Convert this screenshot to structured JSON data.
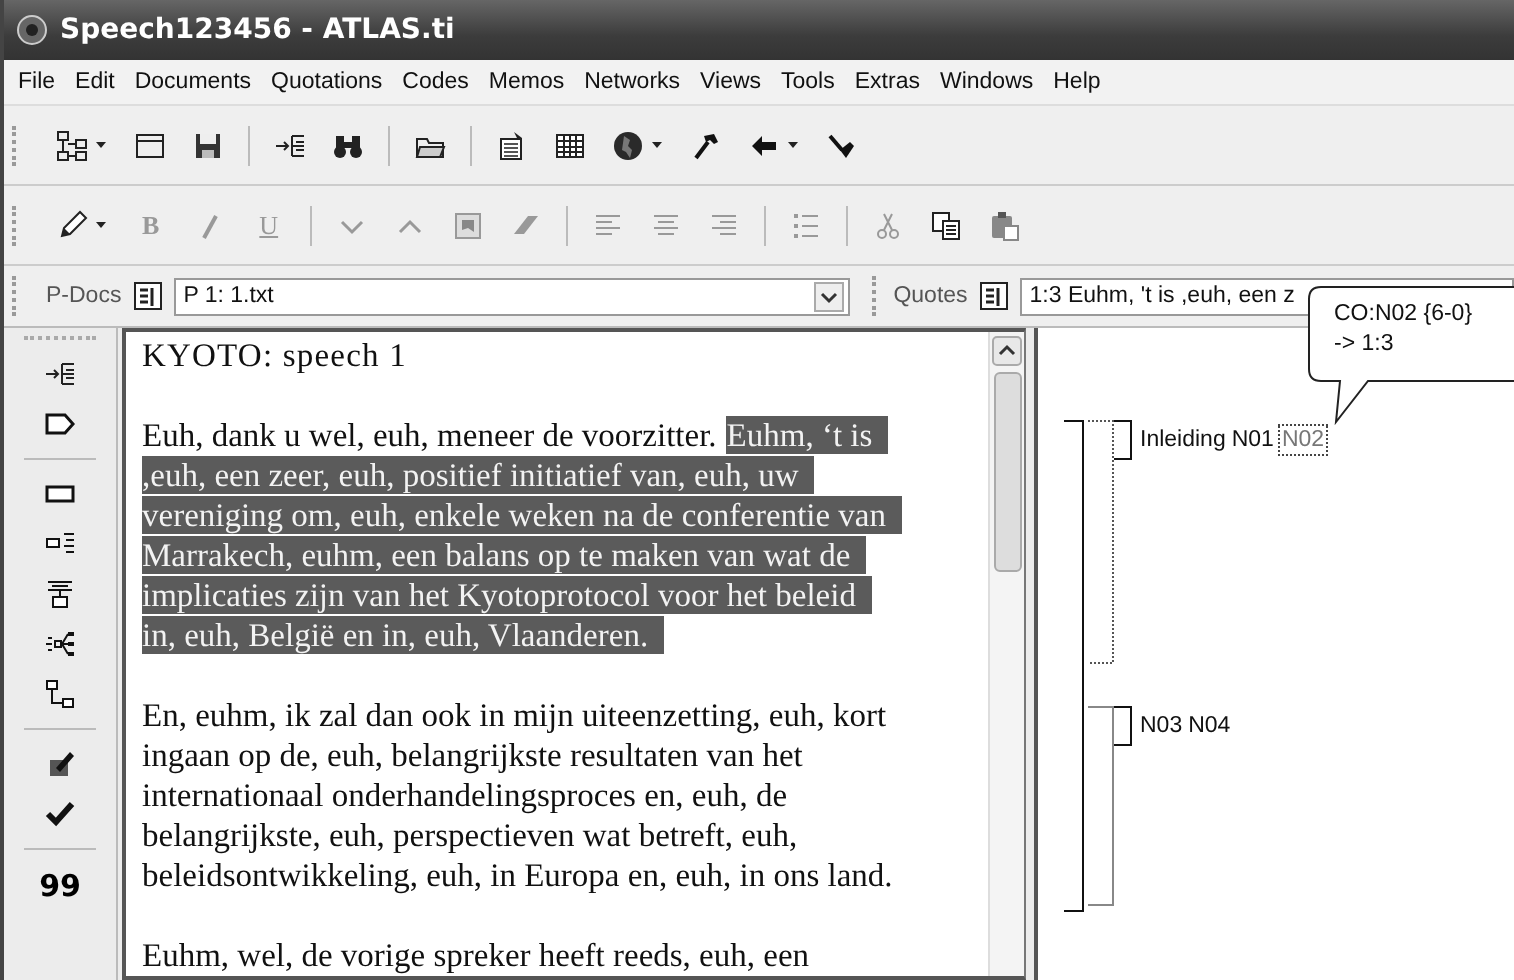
{
  "window": {
    "title": "Speech123456 - ATLAS.ti"
  },
  "menu": [
    "File",
    "Edit",
    "Documents",
    "Quotations",
    "Codes",
    "Memos",
    "Networks",
    "Views",
    "Tools",
    "Extras",
    "Windows",
    "Help"
  ],
  "format_buttons": [
    {
      "label": "B",
      "disabled": true
    },
    {
      "label": "U",
      "disabled": true
    }
  ],
  "pdocs": {
    "label": "P-Docs",
    "value": "P 1: 1.txt"
  },
  "quotes": {
    "label": "Quotes",
    "value": "1:3 Euhm, 't is ,euh, een z"
  },
  "tooltip": {
    "lines": [
      "CO:N02 {6-0}",
      "-> 1:3"
    ]
  },
  "left_toolbar": {
    "label": "99"
  },
  "document": {
    "paragraphs": [
      {
        "kind": "heading",
        "lines": [
          [
            {
              "text": "KYOTO: speech 1",
              "selected": false
            }
          ]
        ]
      },
      {
        "kind": "body",
        "lines": [
          [
            {
              "text": "Euh, dank u wel, euh, meneer de voorzitter.",
              "selected": false
            },
            {
              "text": "Euhm, ‘t is",
              "selected": true
            }
          ],
          [
            {
              "text": ",euh, een zeer, euh, positief initiatief van, euh, uw",
              "selected": true
            }
          ],
          [
            {
              "text": "vereniging om, euh, enkele weken na de conferentie van",
              "selected": true
            }
          ],
          [
            {
              "text": "Marrakech, euhm, een balans op te maken van wat de",
              "selected": true
            }
          ],
          [
            {
              "text": "implicaties zijn van het Kyotoprotocol voor het beleid",
              "selected": true
            }
          ],
          [
            {
              "text": "in, euh, België en in, euh, Vlaanderen.",
              "selected": true
            }
          ]
        ]
      },
      {
        "kind": "body",
        "lines": [
          [
            {
              "text": "En, euhm, ik zal dan ook in mijn uiteenzetting, euh, kort",
              "selected": false
            }
          ],
          [
            {
              "text": "ingaan op de, euh, belangrijkste resultaten van het",
              "selected": false
            }
          ],
          [
            {
              "text": "internationaal onderhandelingsproces en, euh, de",
              "selected": false
            }
          ],
          [
            {
              "text": "belangrijkste, euh, perspectieven wat betreft, euh,",
              "selected": false
            }
          ],
          [
            {
              "text": "beleidsontwikkeling, euh, in Europa en, euh, in ons land.",
              "selected": false
            }
          ]
        ]
      },
      {
        "kind": "body",
        "lines": [
          [
            {
              "text": "Euhm, wel, de vorige spreker heeft reeds, euh, een",
              "selected": false
            }
          ]
        ]
      }
    ]
  },
  "margin": {
    "groups": [
      {
        "codes": [
          {
            "label": "Inleiding",
            "selected": false
          },
          {
            "label": "N01",
            "selected": false
          },
          {
            "label": "N02",
            "selected": true
          }
        ]
      },
      {
        "codes": [
          {
            "label": "N03",
            "selected": false
          },
          {
            "label": "N04",
            "selected": false
          }
        ]
      }
    ]
  }
}
